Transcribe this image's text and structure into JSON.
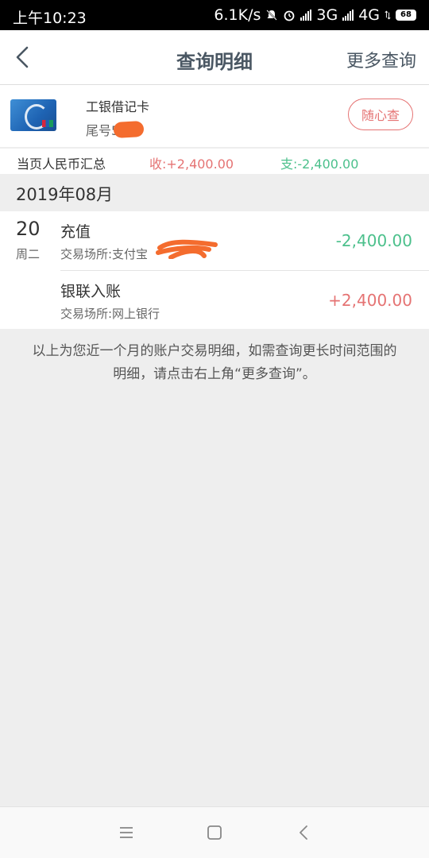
{
  "status_bar": {
    "time": "上午10:23",
    "net_speed": "6.1K/s",
    "network1": "3G",
    "network2": "4G",
    "battery": "68"
  },
  "nav": {
    "title": "查询明细",
    "more_label": "更多查询",
    "back_icon": "chevron-left-icon"
  },
  "card": {
    "name": "工银借记卡",
    "tail_label": "尾号5",
    "button_label": "随心查"
  },
  "summary": {
    "label": "当页人民币汇总",
    "income": "收:+2,400.00",
    "expense": "支:-2,400.00"
  },
  "month": "2019年08月",
  "transactions": [
    {
      "day": "20",
      "weekday": "周二",
      "title": "充值",
      "place": "交易场所:支付宝",
      "amount": "-2,400.00",
      "type": "expense"
    },
    {
      "title": "银联入账",
      "place": "交易场所:网上银行",
      "amount": "+2,400.00",
      "type": "income"
    }
  ],
  "note": {
    "line1": "以上为您近一个月的账户交易明细，如需查询更长时间范围的",
    "line2": "明细，请点击右上角“更多查询”。"
  },
  "colors": {
    "income": "#e57373",
    "expense": "#4cc08c",
    "title": "#4a5763",
    "redaction": "#f46c2e"
  }
}
